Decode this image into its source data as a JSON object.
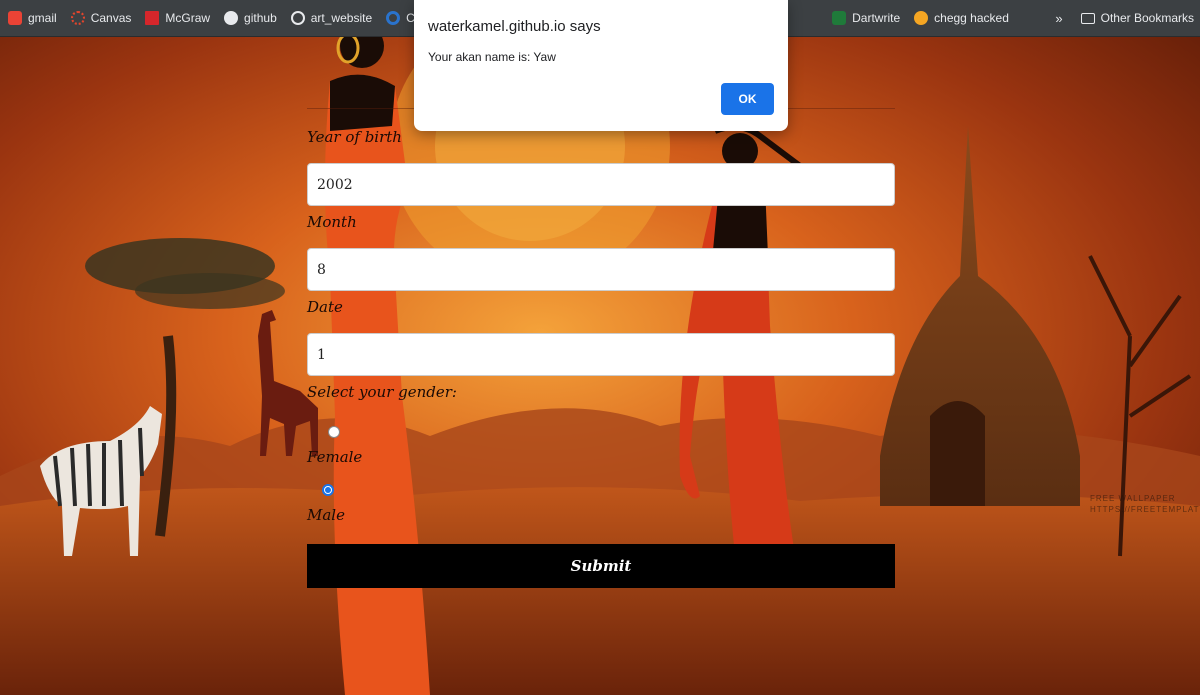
{
  "bookmarks": {
    "items": [
      {
        "label": "gmail",
        "icon": "gmail-icon",
        "color": "#ea4335"
      },
      {
        "label": "Canvas",
        "icon": "canvas-icon",
        "color": "#e4452c"
      },
      {
        "label": "McGraw",
        "icon": "mcgraw-icon",
        "color": "#d6262b"
      },
      {
        "label": "github",
        "icon": "github-icon",
        "color": "#e8eaed"
      },
      {
        "label": "art_website",
        "icon": "globe-icon",
        "color": "#e8eaed"
      },
      {
        "label": "Cours",
        "icon": "coursera-icon",
        "color": "#2a73cc"
      }
    ],
    "right_items": [
      {
        "label": "Dartwrite",
        "icon": "dartwrite-icon",
        "color": "#1f7a3a"
      },
      {
        "label": "chegg hacked",
        "icon": "chegg-icon",
        "color": "#f5a623"
      }
    ],
    "more": "»",
    "other": "Other Bookmarks"
  },
  "dialog": {
    "title": "waterkamel.github.io says",
    "message": "Your akan name is: Yaw",
    "ok_label": "OK"
  },
  "form": {
    "year_label": "Year of birth",
    "year_value": "2002",
    "month_label": "Month",
    "month_value": "8",
    "date_label": "Date",
    "date_value": "1",
    "gender_label": "Select your gender:",
    "female_label": "Female",
    "male_label": "Male",
    "selected_gender": "Male",
    "submit_label": "Submit"
  },
  "watermark": {
    "line1": "FREE WALLPAPER",
    "line2": "HTTPS://FREETEMPLATES.COM"
  },
  "colors": {
    "accent": "#1a73e8",
    "sky_top": "#8a2b0e",
    "sun": "#f0a030"
  }
}
